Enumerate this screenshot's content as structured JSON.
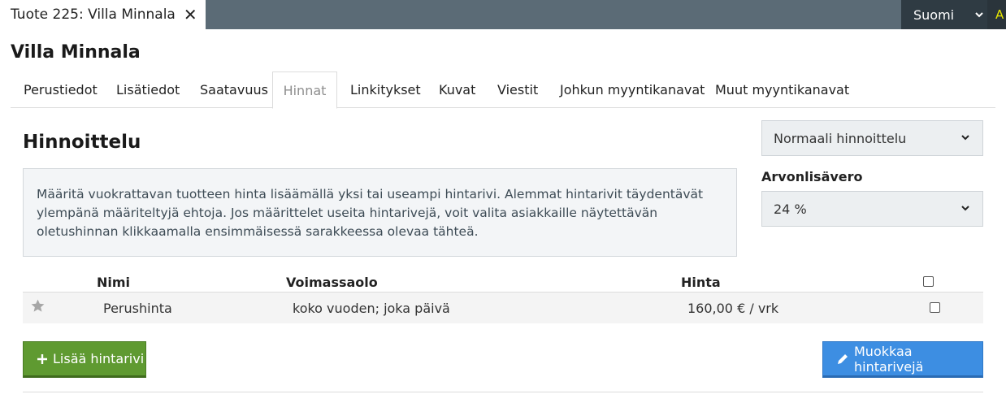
{
  "document_tab": {
    "title": "Tuote 225: Villa Minnala",
    "close_icon": "close-icon"
  },
  "language": {
    "label": "Suomi",
    "icon": "chevron-down-icon"
  },
  "corner_tab": {
    "text": "A"
  },
  "page_title": "Villa Minnala",
  "tabs": [
    {
      "label": "Perustiedot"
    },
    {
      "label": "Lisätiedot"
    },
    {
      "label": "Saatavuus"
    },
    {
      "label": "Hinnat",
      "active": true
    },
    {
      "label": "Linkitykset"
    },
    {
      "label": "Kuvat"
    },
    {
      "label": "Viestit"
    },
    {
      "label": "Johkun myyntikanavat"
    },
    {
      "label": "Muut myyntikanavat"
    }
  ],
  "pricing": {
    "title": "Hinnoittelu",
    "info": "Määritä vuokrattavan tuotteen hinta lisäämällä yksi tai useampi hintarivi. Alemmat hintarivit täydentävät ylempänä määriteltyjä ehtoja. Jos määrittelet useita hintarivejä, voit valita asiakkaille näytettävän oletushinnan klikkaamalla ensimmäisessä sarakkeessa olevaa tähteä.",
    "pricing_type": "Normaali hinnoittelu",
    "vat_label": "Arvonlisävero",
    "vat_value": "24 %"
  },
  "table": {
    "headers": {
      "name": "Nimi",
      "validity": "Voimassaolo",
      "price": "Hinta"
    },
    "rows": [
      {
        "name": "Perushinta",
        "validity": "koko vuoden; joka päivä",
        "price": "160,00 € / vrk"
      }
    ]
  },
  "buttons": {
    "add_label": "Lisää hintarivi",
    "edit_label": "Muokkaa hintarivejä"
  },
  "colors": {
    "topbar": "#5b6b76",
    "green_button": "#5f9a31",
    "blue_button": "#3d8ee2"
  }
}
